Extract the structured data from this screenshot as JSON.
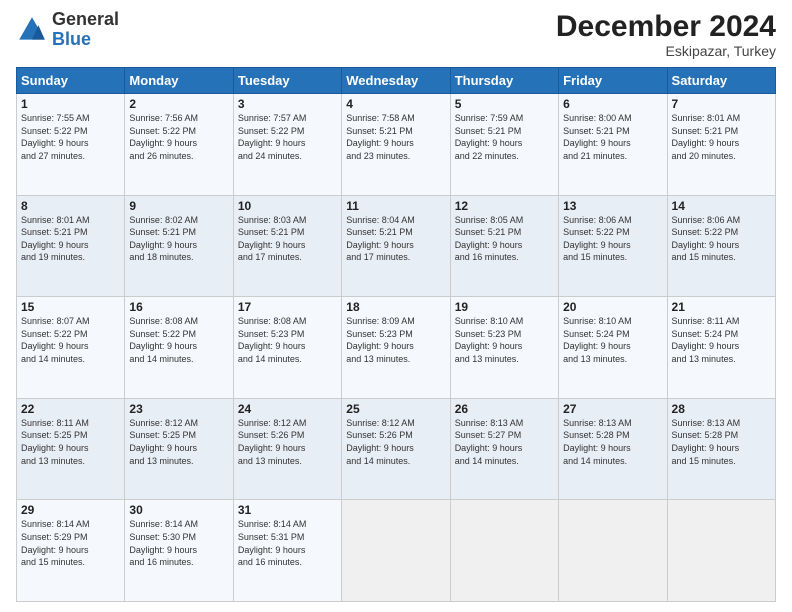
{
  "header": {
    "logo_general": "General",
    "logo_blue": "Blue",
    "month": "December 2024",
    "location": "Eskipazar, Turkey"
  },
  "weekdays": [
    "Sunday",
    "Monday",
    "Tuesday",
    "Wednesday",
    "Thursday",
    "Friday",
    "Saturday"
  ],
  "weeks": [
    [
      {
        "day": "1",
        "info": "Sunrise: 7:55 AM\nSunset: 5:22 PM\nDaylight: 9 hours\nand 27 minutes."
      },
      {
        "day": "2",
        "info": "Sunrise: 7:56 AM\nSunset: 5:22 PM\nDaylight: 9 hours\nand 26 minutes."
      },
      {
        "day": "3",
        "info": "Sunrise: 7:57 AM\nSunset: 5:22 PM\nDaylight: 9 hours\nand 24 minutes."
      },
      {
        "day": "4",
        "info": "Sunrise: 7:58 AM\nSunset: 5:21 PM\nDaylight: 9 hours\nand 23 minutes."
      },
      {
        "day": "5",
        "info": "Sunrise: 7:59 AM\nSunset: 5:21 PM\nDaylight: 9 hours\nand 22 minutes."
      },
      {
        "day": "6",
        "info": "Sunrise: 8:00 AM\nSunset: 5:21 PM\nDaylight: 9 hours\nand 21 minutes."
      },
      {
        "day": "7",
        "info": "Sunrise: 8:01 AM\nSunset: 5:21 PM\nDaylight: 9 hours\nand 20 minutes."
      }
    ],
    [
      {
        "day": "8",
        "info": "Sunrise: 8:01 AM\nSunset: 5:21 PM\nDaylight: 9 hours\nand 19 minutes."
      },
      {
        "day": "9",
        "info": "Sunrise: 8:02 AM\nSunset: 5:21 PM\nDaylight: 9 hours\nand 18 minutes."
      },
      {
        "day": "10",
        "info": "Sunrise: 8:03 AM\nSunset: 5:21 PM\nDaylight: 9 hours\nand 17 minutes."
      },
      {
        "day": "11",
        "info": "Sunrise: 8:04 AM\nSunset: 5:21 PM\nDaylight: 9 hours\nand 17 minutes."
      },
      {
        "day": "12",
        "info": "Sunrise: 8:05 AM\nSunset: 5:21 PM\nDaylight: 9 hours\nand 16 minutes."
      },
      {
        "day": "13",
        "info": "Sunrise: 8:06 AM\nSunset: 5:22 PM\nDaylight: 9 hours\nand 15 minutes."
      },
      {
        "day": "14",
        "info": "Sunrise: 8:06 AM\nSunset: 5:22 PM\nDaylight: 9 hours\nand 15 minutes."
      }
    ],
    [
      {
        "day": "15",
        "info": "Sunrise: 8:07 AM\nSunset: 5:22 PM\nDaylight: 9 hours\nand 14 minutes."
      },
      {
        "day": "16",
        "info": "Sunrise: 8:08 AM\nSunset: 5:22 PM\nDaylight: 9 hours\nand 14 minutes."
      },
      {
        "day": "17",
        "info": "Sunrise: 8:08 AM\nSunset: 5:23 PM\nDaylight: 9 hours\nand 14 minutes."
      },
      {
        "day": "18",
        "info": "Sunrise: 8:09 AM\nSunset: 5:23 PM\nDaylight: 9 hours\nand 13 minutes."
      },
      {
        "day": "19",
        "info": "Sunrise: 8:10 AM\nSunset: 5:23 PM\nDaylight: 9 hours\nand 13 minutes."
      },
      {
        "day": "20",
        "info": "Sunrise: 8:10 AM\nSunset: 5:24 PM\nDaylight: 9 hours\nand 13 minutes."
      },
      {
        "day": "21",
        "info": "Sunrise: 8:11 AM\nSunset: 5:24 PM\nDaylight: 9 hours\nand 13 minutes."
      }
    ],
    [
      {
        "day": "22",
        "info": "Sunrise: 8:11 AM\nSunset: 5:25 PM\nDaylight: 9 hours\nand 13 minutes."
      },
      {
        "day": "23",
        "info": "Sunrise: 8:12 AM\nSunset: 5:25 PM\nDaylight: 9 hours\nand 13 minutes."
      },
      {
        "day": "24",
        "info": "Sunrise: 8:12 AM\nSunset: 5:26 PM\nDaylight: 9 hours\nand 13 minutes."
      },
      {
        "day": "25",
        "info": "Sunrise: 8:12 AM\nSunset: 5:26 PM\nDaylight: 9 hours\nand 14 minutes."
      },
      {
        "day": "26",
        "info": "Sunrise: 8:13 AM\nSunset: 5:27 PM\nDaylight: 9 hours\nand 14 minutes."
      },
      {
        "day": "27",
        "info": "Sunrise: 8:13 AM\nSunset: 5:28 PM\nDaylight: 9 hours\nand 14 minutes."
      },
      {
        "day": "28",
        "info": "Sunrise: 8:13 AM\nSunset: 5:28 PM\nDaylight: 9 hours\nand 15 minutes."
      }
    ],
    [
      {
        "day": "29",
        "info": "Sunrise: 8:14 AM\nSunset: 5:29 PM\nDaylight: 9 hours\nand 15 minutes."
      },
      {
        "day": "30",
        "info": "Sunrise: 8:14 AM\nSunset: 5:30 PM\nDaylight: 9 hours\nand 16 minutes."
      },
      {
        "day": "31",
        "info": "Sunrise: 8:14 AM\nSunset: 5:31 PM\nDaylight: 9 hours\nand 16 minutes."
      },
      null,
      null,
      null,
      null
    ]
  ]
}
